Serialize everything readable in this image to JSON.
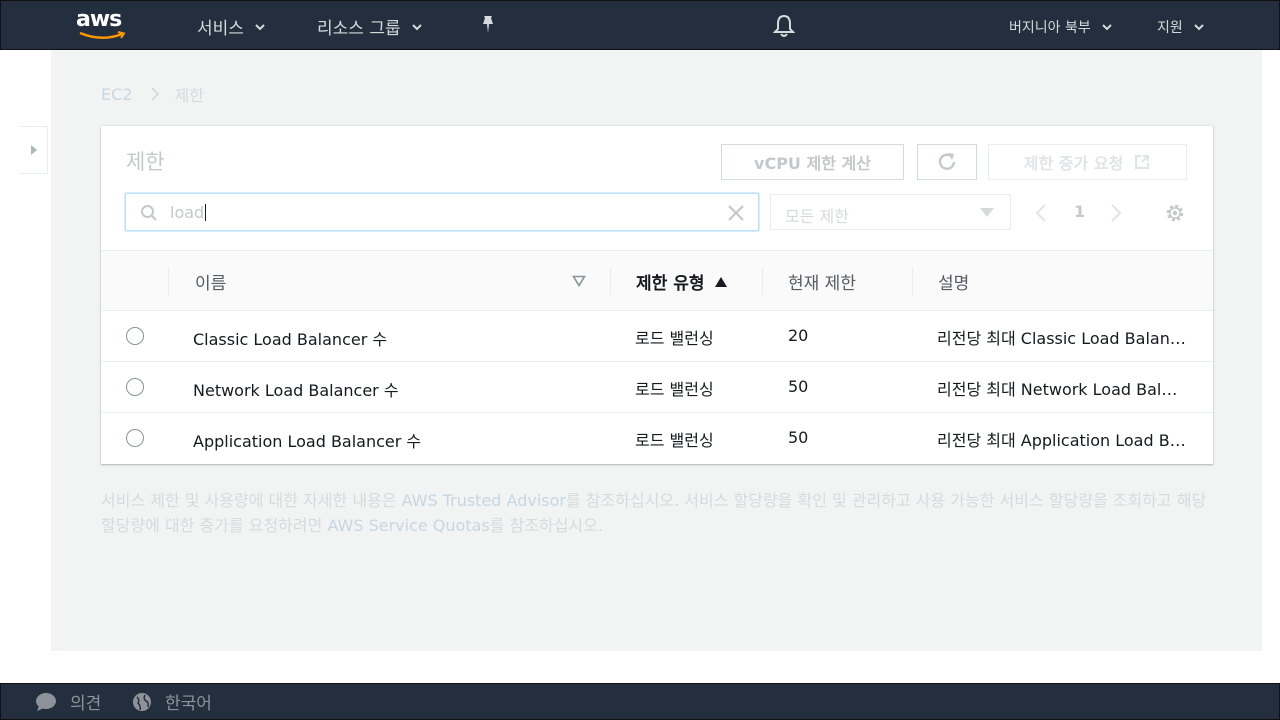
{
  "nav": {
    "logo_text": "aws",
    "services": "서비스",
    "resource_groups": "리소스 그룹",
    "region": "버지니아 북부",
    "support": "지원"
  },
  "breadcrumb": {
    "parent": "EC2",
    "current": "제한"
  },
  "panel": {
    "title": "제한",
    "vcpu_button": "vCPU 제한 계산",
    "increase_button": "제한 증가 요청",
    "search_value": "load",
    "filter_select": "모든 제한",
    "page_number": "1"
  },
  "table": {
    "headers": {
      "name": "이름",
      "type": "제한 유형",
      "current": "현재 제한",
      "description": "설명"
    },
    "rows": [
      {
        "name": "Classic Load Balancer 수",
        "type": "로드 밸런싱",
        "value": "20",
        "description": "리전당 최대 Classic Load Balancer 수"
      },
      {
        "name": "Network Load Balancer 수",
        "type": "로드 밸런싱",
        "value": "50",
        "description": "리전당 최대 Network Load Balancer 수"
      },
      {
        "name": "Application Load Balancer 수",
        "type": "로드 밸런싱",
        "value": "50",
        "description": "리전당 최대 Application Load Balancer 수"
      }
    ]
  },
  "note": {
    "part1": "서비스 제한 및 사용량에 대한 자세한 내용은 ",
    "link1": "AWS Trusted Advisor",
    "part2": "를 참조하십시오. 서비스 할당량을 확인 및 관리하고 사용 가능한 서비스 할당량을 조회하고 해당 할당량에 대한 증가를 요청하려면 ",
    "link2": "AWS Service Quotas",
    "part3": "를 참조하십시오."
  },
  "footer": {
    "feedback": "의견",
    "language": "한국어"
  },
  "colors": {
    "nav_bg": "#232f3e",
    "aws_orange": "#ff9900",
    "page_bg": "#f2f3f3"
  }
}
